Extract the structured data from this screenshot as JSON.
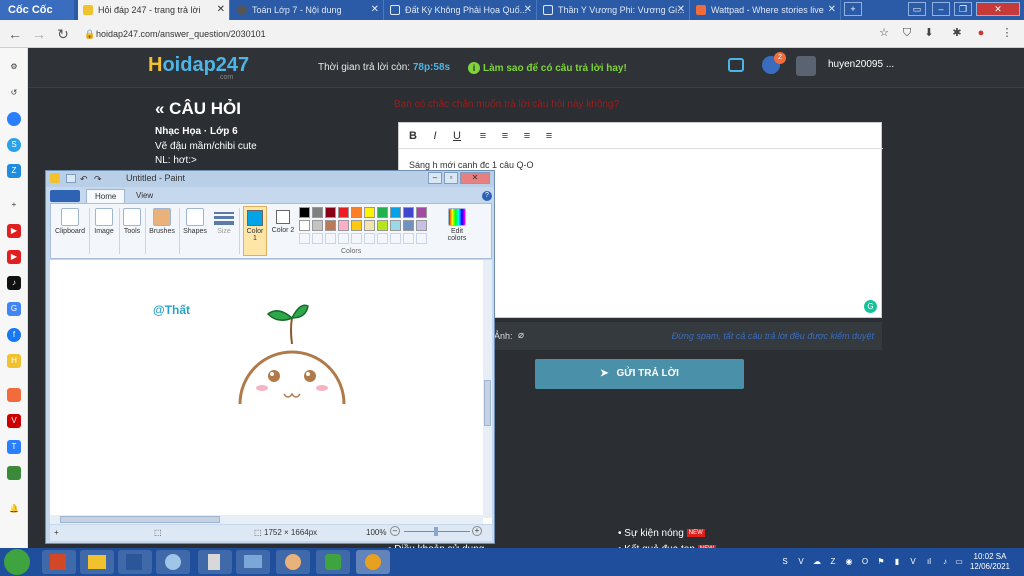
{
  "browser": {
    "brand": "Cốc Cốc",
    "tabs": [
      {
        "title": "Hỏi đáp 247 - trang trả lời",
        "active": true
      },
      {
        "title": "Toán Lớp 7 - Nội dung",
        "active": false
      },
      {
        "title": "Đất Kỳ Không Phải Họa Quố...",
        "active": false
      },
      {
        "title": "Thần Y Vương Phi: Vương Gi...",
        "active": false
      },
      {
        "title": "Wattpad - Where stories live",
        "active": false
      }
    ],
    "url": "hoidap247.com/answer_question/2030101",
    "icons": {
      "back": "back-arrow-icon",
      "forward": "forward-arrow-icon",
      "reload": "reload-icon",
      "star": "star-icon",
      "extensions": "puzzle-icon",
      "menu": "kebab-menu-icon"
    }
  },
  "site": {
    "logo": {
      "h": "H",
      "rest": "oidap247",
      "com": ".com"
    },
    "timer_label": "Thời gian trả lời còn:",
    "timer_value": "78p:58s",
    "howto": "Làm sao để có câu trả lời hay!",
    "notif_count": "2",
    "username": "huyen20095 ..."
  },
  "question": {
    "title": "« CÂU HỎI",
    "subject": "Nhạc Họa · Lớp 6",
    "lines": [
      "Vẽ đậu mầm/chibi cute",
      "NL: hơt:>"
    ],
    "warning": "Bạn có chắc chắn muốn trả lời câu hỏi này không?"
  },
  "editor": {
    "tools": [
      "B",
      "I",
      "U",
      "≡",
      "≡",
      "≡",
      "≡"
    ],
    "text": "Sáng h mới canh đc 1 câu Q-O",
    "attach_label": "Ảnh:",
    "note": "Đừng spam, tất cả câu trả lời đều được kiểm duyệt",
    "submit": "GỬI TRẢ LỜI"
  },
  "footer": {
    "links": [
      "Sự kiện nóng",
      "Kết quả đua top"
    ],
    "new_tag": "NEW",
    "partial": "Điều khoản sử dụng"
  },
  "paint": {
    "title": "Untitled - Paint",
    "tabs": [
      "Home",
      "View"
    ],
    "groups": [
      "Clipboard",
      "Image",
      "Tools",
      "Brushes",
      "Shapes",
      "Size",
      "Color 1",
      "Color 2",
      "Colors",
      "Edit colors"
    ],
    "canvas_text": "@Thất",
    "dimensions": "1752 × 1664px",
    "zoom": "100%",
    "palette": [
      "#000000",
      "#7f7f7f",
      "#880015",
      "#ed1c24",
      "#ff7f27",
      "#fff200",
      "#22b14c",
      "#00a2e8",
      "#3f48cc",
      "#a349a4",
      "#ffffff",
      "#c3c3c3",
      "#b97a57",
      "#ffaec9",
      "#ffc90e",
      "#efe4b0",
      "#b5e61d",
      "#99d9ea",
      "#7092be",
      "#c8bfe7"
    ],
    "color1": "#00a2e8",
    "color2": "#ffffff"
  },
  "taskbar": {
    "time": "10:02 SA",
    "date": "12/06/2021"
  }
}
